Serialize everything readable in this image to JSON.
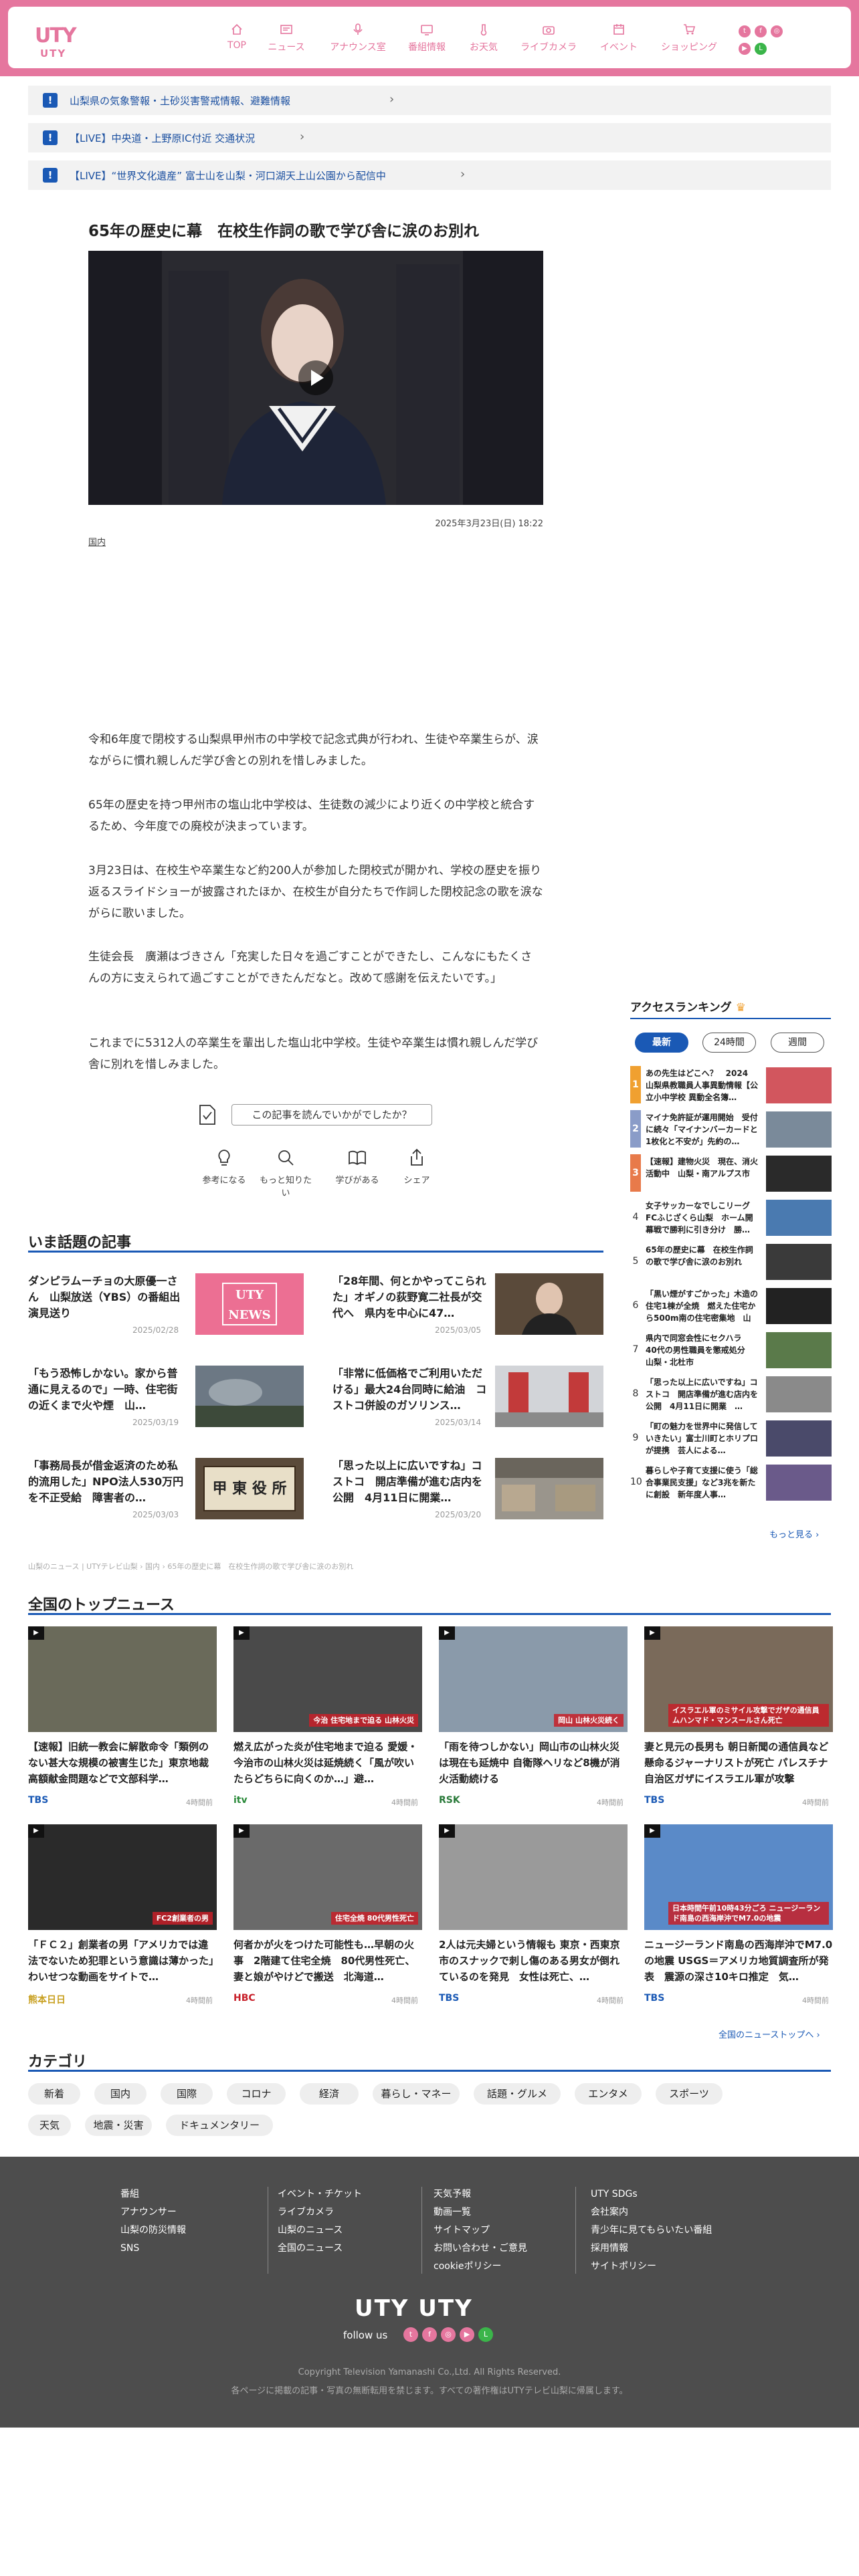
{
  "brand": {
    "logo_kana": "UTY",
    "logo_text": "UTY",
    "accent": "#e5769e",
    "link_blue": "#1a59b5"
  },
  "nav": [
    {
      "label": "TOP",
      "icon": "home-icon"
    },
    {
      "label": "ニュース",
      "icon": "news-icon"
    },
    {
      "label": "アナウンス室",
      "icon": "microphone-icon"
    },
    {
      "label": "番組情報",
      "icon": "tv-icon"
    },
    {
      "label": "お天気",
      "icon": "thermometer-icon"
    },
    {
      "label": "ライブカメラ",
      "icon": "camera-icon"
    },
    {
      "label": "イベント",
      "icon": "calendar-icon"
    },
    {
      "label": "ショッピング",
      "icon": "cart-icon"
    }
  ],
  "alerts": [
    {
      "text": "山梨県の気象警報・土砂災害警戒情報、避難情報"
    },
    {
      "text": "【LIVE】中央道・上野原IC付近 交通状況"
    },
    {
      "text": "【LIVE】“世界文化遺産” 富士山を山梨・河口湖天上山公園から配信中"
    }
  ],
  "article": {
    "title": "65年の歴史に幕　在校生作詞の歌で学び舎に涙のお別れ",
    "date": "2025年3月23日(日) 18:22",
    "category": "国内",
    "paragraphs": [
      "令和6年度で閉校する山梨県甲州市の中学校で記念式典が行われ、生徒や卒業生らが、涙ながらに慣れ親しんだ学び舎との別れを惜しみました。",
      "65年の歴史を持つ甲州市の塩山北中学校は、生徒数の減少により近くの中学校と統合するため、今年度での廃校が決まっています。",
      "3月23日は、在校生や卒業生など約200人が参加した閉校式が開かれ、学校の歴史を振り返るスライドショーが披露されたほか、在校生が自分たちで作詞した閉校記念の歌を涙ながらに歌いました。",
      "生徒会長　廣瀬はづきさん「充実した日々を過ごすことができたし、こんなにもたくさんの方に支えられて過ごすことができたんだなと。改めて感謝を伝えたいです。」",
      "これまでに5312人の卒業生を輩出した塩山北中学校。生徒や卒業生は慣れ親しんだ学び舎に別れを惜しみました。"
    ],
    "survey": "この記事を読んでいかがでしたか？",
    "reactions": [
      "参考になる",
      "もっと知りたい",
      "学びがある",
      "シェア"
    ]
  },
  "trending": {
    "heading": "いま話題の記事",
    "items": [
      {
        "title": "ダンピラムーチョの大原優一さん　山梨放送（YBS）の番組出演見送り",
        "date": "2025/02/28",
        "thumb": "UTY NEWS"
      },
      {
        "title": "「28年間、何とかやってこられた」オギノの荻野寛二社長が交代へ　県内を中心に47…",
        "date": "2025/03/05"
      },
      {
        "title": "「もう恐怖しかない。家から普通に見えるので」一時、住宅街の近くまで火や煙　山…",
        "date": "2025/03/19"
      },
      {
        "title": "「非常に低価格でご利用いただける」最大24台同時に給油　コストコ併設のガソリンス…",
        "date": "2025/03/14"
      },
      {
        "title": "「事務局長が借金返済のため私的流用した」NPO法人530万円を不正受給　障害者の…",
        "date": "2025/03/03",
        "thumb": "甲 東 役 所"
      },
      {
        "title": "「思った以上に広いですね」コストコ　開店準備が進む店内を公開　4月11日に開業…",
        "date": "2025/03/20"
      }
    ]
  },
  "ranking": {
    "heading": "アクセスランキング",
    "tabs": [
      "最新",
      "24時間",
      "週間"
    ],
    "items": [
      {
        "n": "1",
        "text": "あの先生はどこへ？　2024　山梨県教職員人事異動情報【公立小中学校 異動全名簿…"
      },
      {
        "n": "2",
        "text": "マイナ免許証が運用開始　受付に続々「マイナンバーカードと1枚化と不安が」先約の…"
      },
      {
        "n": "3",
        "text": "【速報】建物火災　現在、消火活動中　山梨・南アルプス市"
      },
      {
        "n": "4",
        "text": "女子サッカーなでしこリーグFCふじざくら山梨　ホーム開幕戦で勝利に引き分け　勝…"
      },
      {
        "n": "5",
        "text": "65年の歴史に幕　在校生作詞の歌で学び舎に涙のお別れ"
      },
      {
        "n": "6",
        "text": "「黒い煙がすごかった」木造の住宅1棟が全焼　燃えた住宅から500m南の住宅密集地　山梨…"
      },
      {
        "n": "7",
        "text": "県内で同窓会性にセクハラ　40代の男性職員を懲戒処分　山梨・北杜市"
      },
      {
        "n": "8",
        "text": "「思った以上に広いですね」コストコ　開店準備が進む店内を公開　4月11日に開業　…"
      },
      {
        "n": "9",
        "text": "「町の魅力を世界中に発信していきたい」富士川町とホリプロが提携　芸人による…"
      },
      {
        "n": "10",
        "text": "暮らしや子育て支援に使う「総合事業民支援」など3兆を新たに創設　新年度人事…"
      }
    ],
    "more": "もっと見る ›"
  },
  "breadcrumb": "山梨のニュース | UTYテレビ山梨 › 国内 › 65年の歴史に幕　在校生作詞の歌で学び舎に涙のお別れ",
  "top_news": {
    "heading": "全国のトップニュース",
    "items": [
      {
        "title": "【速報】旧統一教会に解散命令「類例のない甚大な規模の被害生じた」東京地裁　高額献金問題などで文部科学…",
        "source": "TBS",
        "ago": "4時間前",
        "caption": ""
      },
      {
        "title": "燃え広がった炎が住宅地まで迫る 愛媛・今治市の山林火災は延焼続く「風が吹いたらどちらに向くのか…」避…",
        "source": "itv",
        "ago": "4時間前",
        "caption": "今治 住宅地まで迫る 山林火災"
      },
      {
        "title": "「雨を待つしかない」岡山市の山林火災は現在も延焼中 自衛隊ヘリなど8機が消火活動続ける",
        "source": "RSK",
        "ago": "4時間前",
        "caption": "岡山 山林火災続く"
      },
      {
        "title": "妻と見元の長男も 朝日新聞の通信員など懸命るジャーナリストが死亡 パレスチナ自治区ガザにイスラエル軍が攻撃",
        "source": "TBS",
        "ago": "4時間前",
        "caption": "イスラエル軍のミサイル攻撃でガザの通信員ムハンマド・マンスールさん死亡"
      },
      {
        "title": "「ＦＣ２」創業者の男「アメリカでは違法でないため犯罪という意識は薄かった」わいせつな動画をサイトで…",
        "source": "熊本日日",
        "ago": "4時間前",
        "caption": "FC2創業者の男"
      },
      {
        "title": "何者かが火をつけた可能性も…早朝の火事　2階建て住宅全焼　80代男性死亡、妻と娘がやけどで搬送　北海道…",
        "source": "HBC",
        "ago": "4時間前",
        "caption": "住宅全焼 80代男性死亡"
      },
      {
        "title": "2人は元夫婦という情報も 東京・西東京市のスナックで刺し傷のある男女が倒れているのを発見　女性は死亡、…",
        "source": "TBS",
        "ago": "4時間前",
        "caption": ""
      },
      {
        "title": "ニュージーランド南島の西海岸沖でM7.0の地震 USGS＝アメリカ地質調査所が発表　震源の深さ10キロ推定　気…",
        "source": "TBS",
        "ago": "4時間前",
        "caption": "日本時間午前10時43分ごろ ニュージーランド南島の西海岸沖でM7.0の地震"
      }
    ],
    "more": "全国のニューストップへ ›"
  },
  "categories": {
    "heading": "カテゴリ",
    "items": [
      "新着",
      "国内",
      "国際",
      "コロナ",
      "経済",
      "暮らし・マネー",
      "話題・グルメ",
      "エンタメ",
      "スポーツ",
      "天気",
      "地震・災害",
      "ドキュメンタリー"
    ]
  },
  "footer": {
    "col1": [
      "番組",
      "アナウンサー",
      "山梨の防災情報",
      "SNS"
    ],
    "col2": [
      "イベント・チケット",
      "ライブカメラ",
      "山梨のニュース",
      "全国のニュース"
    ],
    "col3": [
      "天気予報",
      "動画一覧",
      "サイトマップ",
      "お問い合わせ・ご意見",
      "cookieポリシー"
    ],
    "col4": [
      "UTY SDGs",
      "会社案内",
      "青少年に見てもらいたい番組",
      "採用情報",
      "サイトポリシー"
    ],
    "follow": "follow us",
    "copyright": "Copyright Television Yamanashi Co.,Ltd. All Rights Reserved.",
    "notice": "各ページに掲載の記事・写真の無断転用を禁じます。すべての著作権はUTYテレビ山梨に帰属します。"
  }
}
